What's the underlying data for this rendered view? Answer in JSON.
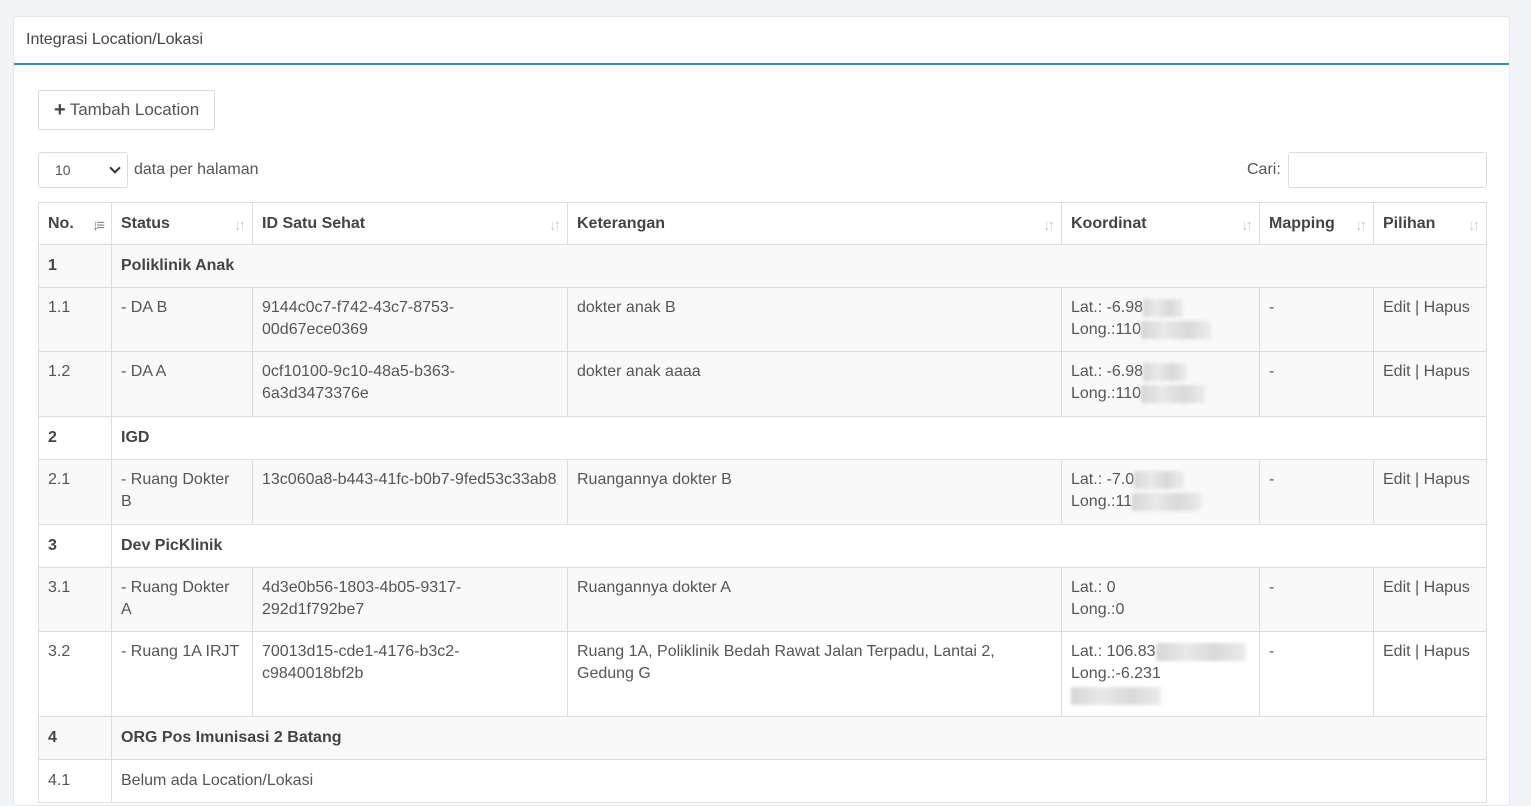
{
  "header": {
    "title": "Integrasi Location/Lokasi"
  },
  "toolbar": {
    "add_label": "Tambah Location"
  },
  "length": {
    "value": "10",
    "label": "data per halaman"
  },
  "search": {
    "label": "Cari:",
    "value": ""
  },
  "columns": [
    "No.",
    "Status",
    "ID Satu Sehat",
    "Keterangan",
    "Koordinat",
    "Mapping",
    "Pilihan"
  ],
  "rows": [
    {
      "type": "group",
      "no": "1",
      "name": "Poliklinik Anak"
    },
    {
      "type": "item",
      "no": "1.1",
      "status": "- DA B",
      "id": "9144c0c7-f742-43c7-8753-00d67ece0369",
      "ket": "dokter anak B",
      "lat": "Lat.: -6.98",
      "long": "Long.:110",
      "mapping": "-",
      "edit": "Edit",
      "sep": "|",
      "hapus": "Hapus"
    },
    {
      "type": "item",
      "no": "1.2",
      "status": "- DA A",
      "id": "0cf10100-9c10-48a5-b363-6a3d3473376e",
      "ket": "dokter anak aaaa",
      "lat": "Lat.: -6.98",
      "long": "Long.:110",
      "mapping": "-",
      "edit": "Edit",
      "sep": "|",
      "hapus": "Hapus"
    },
    {
      "type": "group",
      "no": "2",
      "name": "IGD"
    },
    {
      "type": "item",
      "no": "2.1",
      "status": "- Ruang Dokter B",
      "id": "13c060a8-b443-41fc-b0b7-9fed53c33ab8",
      "ket": "Ruangannya dokter B",
      "lat": "Lat.: -7.0",
      "long": "Long.:11",
      "mapping": "-",
      "edit": "Edit",
      "sep": "|",
      "hapus": "Hapus"
    },
    {
      "type": "group",
      "no": "3",
      "name": "Dev PicKlinik"
    },
    {
      "type": "item",
      "no": "3.1",
      "status": "- Ruang Dokter A",
      "id": "4d3e0b56-1803-4b05-9317-292d1f792be7",
      "ket": "Ruangannya dokter A",
      "lat": "Lat.: 0",
      "long": "Long.:0",
      "mapping": "-",
      "edit": "Edit",
      "sep": "|",
      "hapus": "Hapus"
    },
    {
      "type": "item",
      "no": "3.2",
      "status": "- Ruang 1A IRJT",
      "id": "70013d15-cde1-4176-b3c2-c9840018bf2b",
      "ket": "Ruang 1A, Poliklinik Bedah Rawat Jalan Terpadu, Lantai 2, Gedung G",
      "lat": "Lat.: 106.83",
      "long": "Long.:-6.231",
      "mapping": "-",
      "edit": "Edit",
      "sep": "|",
      "hapus": "Hapus"
    },
    {
      "type": "group",
      "no": "4",
      "name": "ORG Pos Imunisasi 2 Batang"
    },
    {
      "type": "empty",
      "no": "4.1",
      "text": "Belum ada Location/Lokasi"
    }
  ]
}
